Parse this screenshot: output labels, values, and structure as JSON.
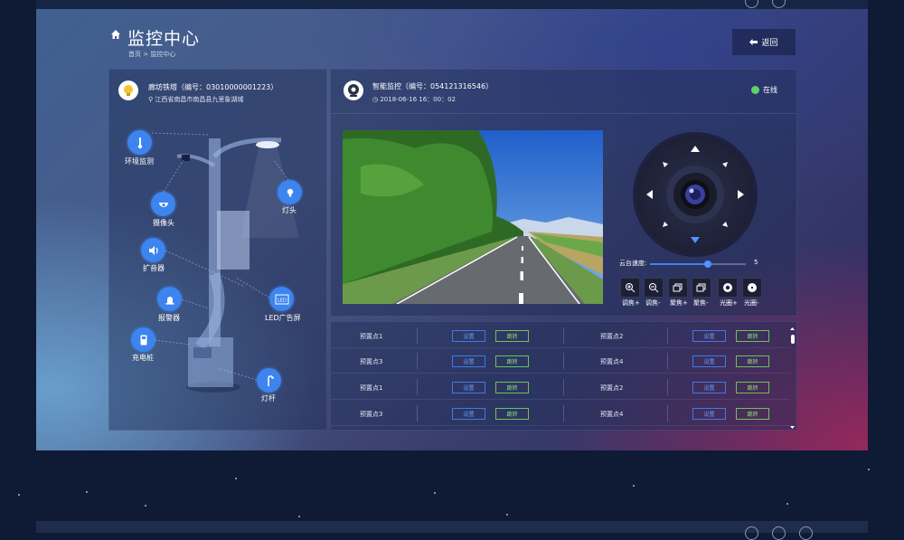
{
  "header": {
    "title": "监控中心",
    "breadcrumb": "首页 > 监控中心",
    "back_label": "返回"
  },
  "tower": {
    "name": "廊坊铁塔（编号：03010000001223）",
    "address": "江西省南昌市南昌县九里象湖城"
  },
  "devices": [
    {
      "label": "环境监测",
      "icon": "thermometer-icon"
    },
    {
      "label": "摄像头",
      "icon": "dome-camera-icon"
    },
    {
      "label": "扩音器",
      "icon": "speaker-icon"
    },
    {
      "label": "报警器",
      "icon": "alarm-light-icon"
    },
    {
      "label": "充电桩",
      "icon": "charging-pile-icon"
    },
    {
      "label": "灯头",
      "icon": "light-bulb-icon"
    },
    {
      "label": "LED广告屏",
      "icon": "led-screen-icon"
    },
    {
      "label": "灯杆",
      "icon": "lamp-post-icon"
    }
  ],
  "camera": {
    "name": "智能监控（编号：054121316546）",
    "datetime": "2018-06-16  16：00：02",
    "status": "在线",
    "status_color": "#5fd06a"
  },
  "ptz": {
    "speed_label": "云台速度:",
    "speed_value": "5",
    "speed_fraction": 0.6
  },
  "controls": [
    {
      "label": "调焦+",
      "icon": "zoom-in-icon"
    },
    {
      "label": "调焦-",
      "icon": "zoom-out-icon"
    },
    {
      "label": "聚焦+",
      "icon": "focus-plus-icon"
    },
    {
      "label": "聚焦-",
      "icon": "focus-minus-icon"
    },
    {
      "label": "光圈+",
      "icon": "iris-open-icon"
    },
    {
      "label": "光圈-",
      "icon": "iris-close-icon"
    }
  ],
  "presets": [
    {
      "left": "预置点1",
      "right": "预置点2"
    },
    {
      "left": "预置点3",
      "right": "预置点4"
    },
    {
      "left": "预置点1",
      "right": "预置点2"
    },
    {
      "left": "预置点3",
      "right": "预置点4"
    }
  ],
  "preset_buttons": {
    "set": "设置",
    "jump": "跳转"
  },
  "colors": {
    "accent": "#3d84ee",
    "jump": "#6cc35a"
  }
}
